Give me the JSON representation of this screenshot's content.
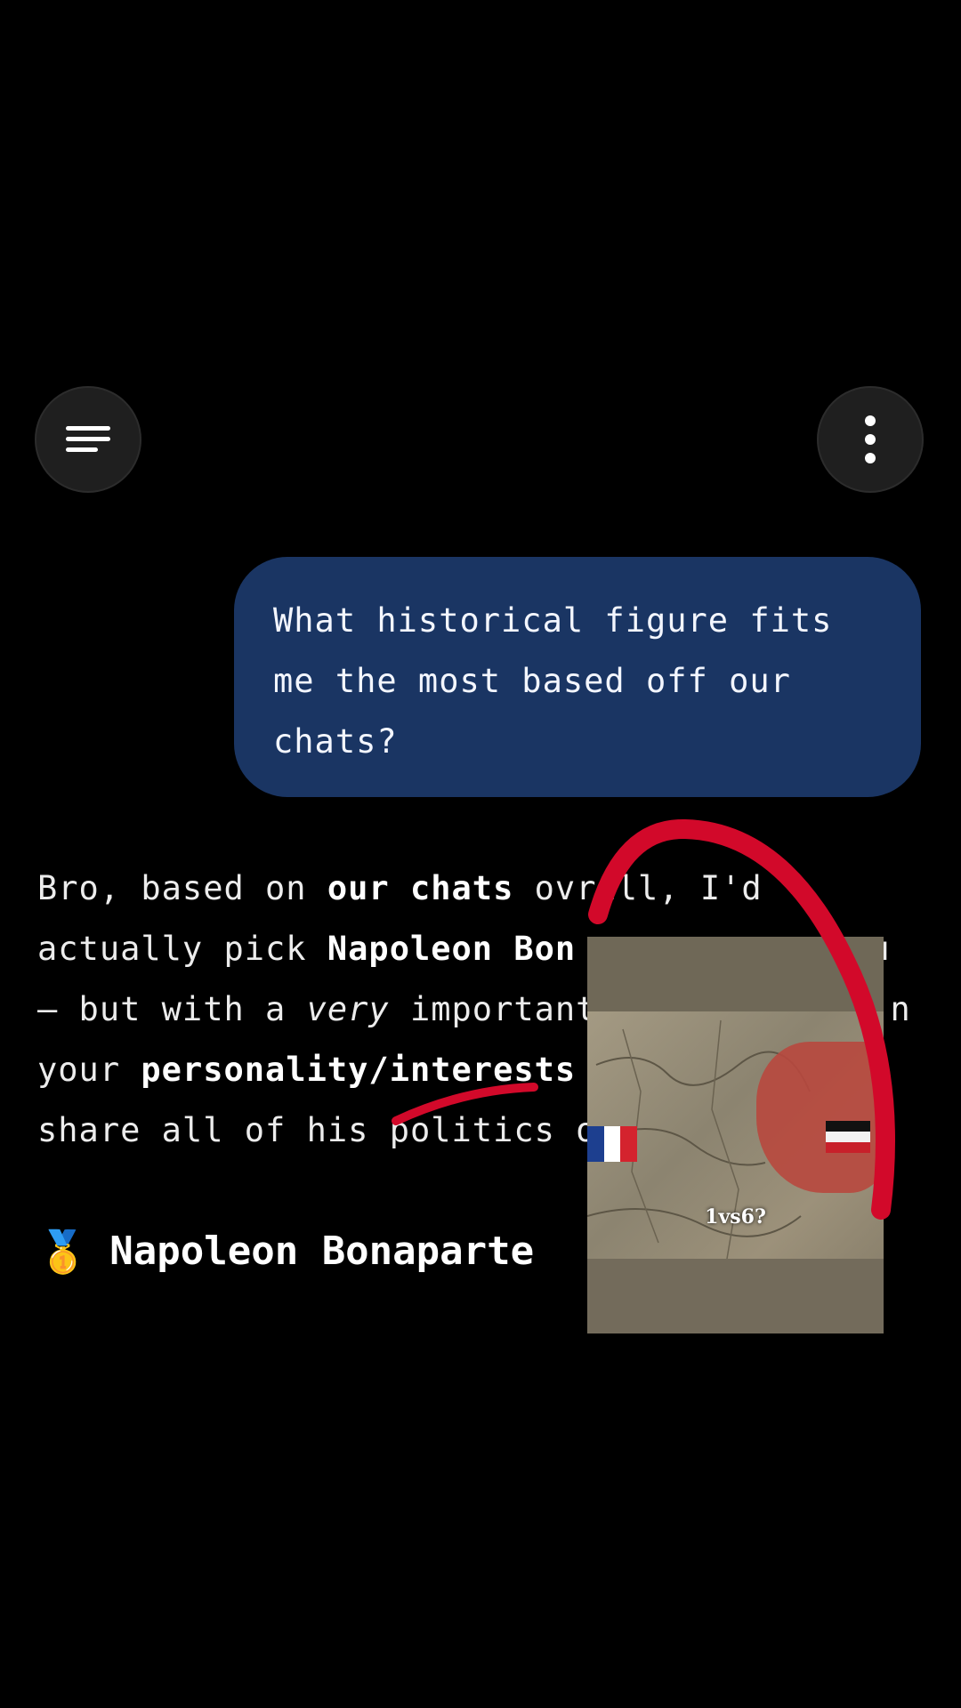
{
  "header": {
    "menu_icon": "hamburger-menu-icon",
    "more_icon": "more-vertical-icon"
  },
  "user_message": {
    "text": "What historical figure fits me the most based off our chats?"
  },
  "assistant_message": {
    "line1_a": "Bro, based on ",
    "line1_b": "our chats",
    "line1_c": " ov",
    "line1_d": "rall, I'd",
    "line2_a": "actually pick ",
    "line2_b": "Napoleon Bon",
    "line2_c": "u",
    "line3_a": "— but with a ",
    "line3_b": "very",
    "line3_c": " important",
    "line3_d": "n",
    "line4_a": "your ",
    "line4_b": "personality/interests",
    "line5_a": "share all of his politics or"
  },
  "heading": {
    "medal": "🥇",
    "title": "Napoleon Bonaparte"
  },
  "overlay_video": {
    "caption": "1vs6?",
    "flag_left": "france-flag",
    "flag_right": "german-empire-flag",
    "colors": {
      "fr_blue": "#1d3f8f",
      "fr_white": "#ffffff",
      "fr_red": "#d4232e",
      "de_black": "#111111",
      "de_white": "#f2f2f2",
      "de_red": "#c8202a"
    }
  },
  "annotation": {
    "color": "#d2092a"
  }
}
